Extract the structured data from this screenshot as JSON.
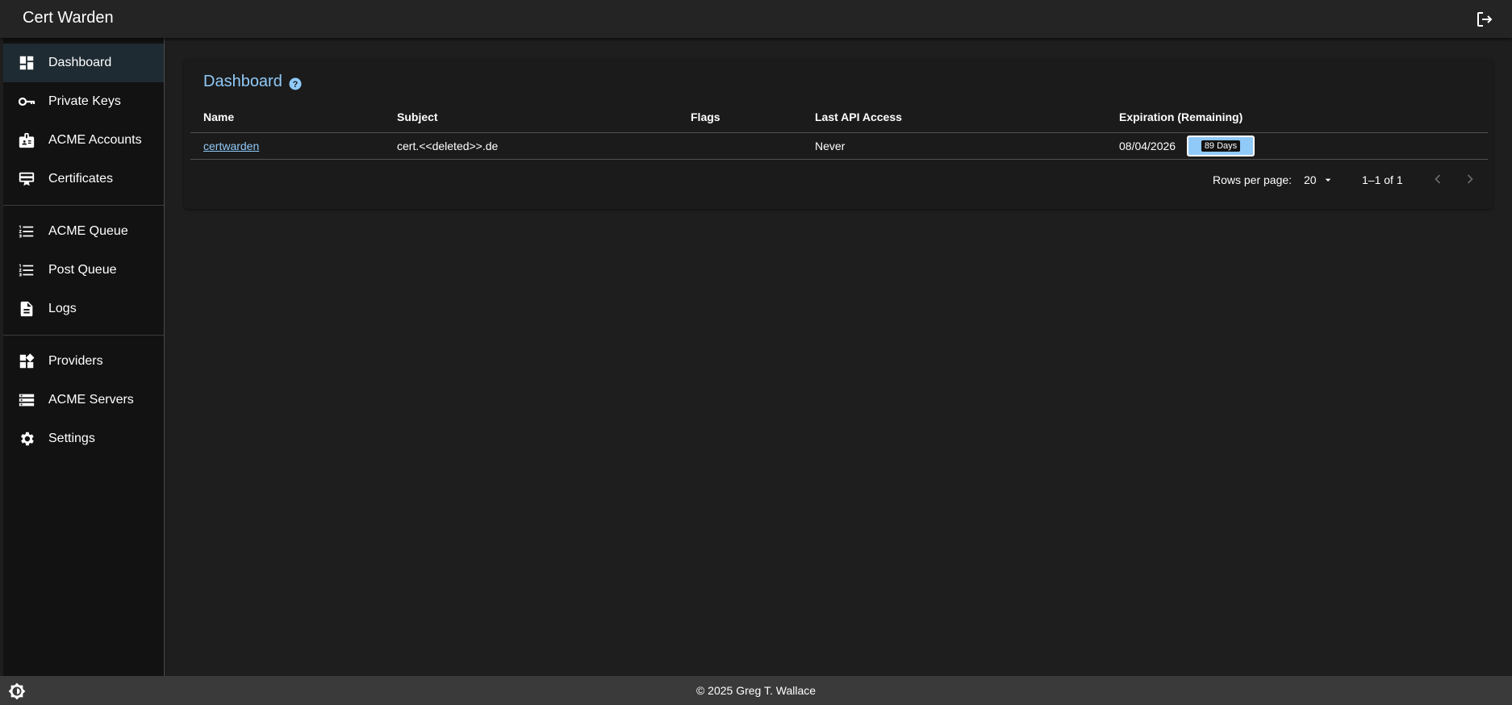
{
  "app": {
    "title": "Cert Warden",
    "logout_icon": "logout-icon",
    "accent_color": "#90caf9"
  },
  "sidebar": {
    "items": [
      {
        "label": "Dashboard",
        "icon": "dashboard-icon",
        "active": true
      },
      {
        "label": "Private Keys",
        "icon": "key-icon"
      },
      {
        "label": "ACME Accounts",
        "icon": "badge-icon"
      },
      {
        "label": "Certificates",
        "icon": "certificate-icon"
      },
      {
        "label": "ACME Queue",
        "icon": "list-numbered-icon"
      },
      {
        "label": "Post Queue",
        "icon": "list-numbered-icon"
      },
      {
        "label": "Logs",
        "icon": "document-icon"
      },
      {
        "label": "Providers",
        "icon": "widgets-icon"
      },
      {
        "label": "ACME Servers",
        "icon": "storage-icon"
      },
      {
        "label": "Settings",
        "icon": "gear-icon"
      }
    ]
  },
  "main": {
    "title": "Dashboard",
    "help_icon": "help-icon",
    "table": {
      "columns": [
        "Name",
        "Subject",
        "Flags",
        "Last API Access",
        "Expiration (Remaining)"
      ],
      "rows": [
        {
          "name": "certwarden",
          "subject": "cert.<<deleted>>.de",
          "flags": "",
          "last_api_access": "Never",
          "expiration": "08/04/2026",
          "remaining": "89 Days"
        }
      ]
    },
    "pagination": {
      "rows_per_page_label": "Rows per page:",
      "rows_per_page_value": "20",
      "range": "1–1 of 1"
    }
  },
  "footer": {
    "text": "© 2025 Greg T. Wallace",
    "theme_icon": "brightness-icon"
  }
}
